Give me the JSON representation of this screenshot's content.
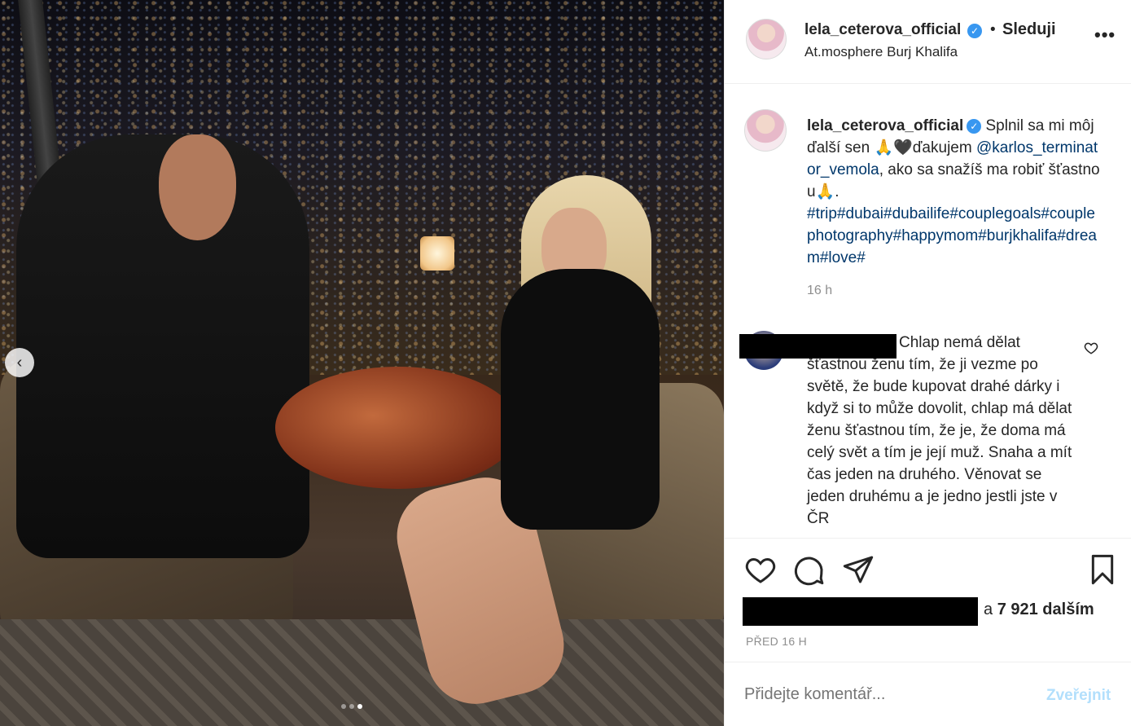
{
  "post": {
    "author": "lela_ceterova_official",
    "follow_label": "Sleduji",
    "separator": "•",
    "location": "At.mosphere Burj Khalifa",
    "more_label": "•••",
    "verified_icon": "✓"
  },
  "caption": {
    "username": "lela_ceterova_official",
    "text_before_mention": " Splnil sa mi môj ďalší sen 🙏🖤ďakujem ",
    "mention": "@karlos_terminator_vemola",
    "text_after_mention": ", ako sa snažíš ma robiť šťastnou🙏.",
    "hashtags": "#trip#dubai#dubailife#couplegoals#coupleph0tography#happymom#burjkhalifa#dream#love#",
    "time": "16 h"
  },
  "comment": {
    "text": "Chlap nemá dělat šťastnou ženu tím, že ji vezme po světě, že bude kupovat drahé dárky i když si to může dovolit, chlap má dělat ženu šťastnou tím, že je, že doma má celý svět a tím je její muž. Snaha a mít čas jeden na druhého. Věnovat se jeden druhému a je jedno jestli jste v ČR"
  },
  "likes": {
    "connector": "a",
    "count_text": "7 921 dalším"
  },
  "timestamp": "PŘED 16 H",
  "add_comment": {
    "placeholder": "Přidejte komentář...",
    "post_label": "Zveřejnit"
  },
  "carousel": {
    "prev_icon": "‹",
    "slide_count": 3,
    "active_slide": 3
  },
  "colors": {
    "link": "#00376b",
    "verified": "#3897f0",
    "muted": "#8e8e8e",
    "post_disabled": "#b2dffc"
  }
}
